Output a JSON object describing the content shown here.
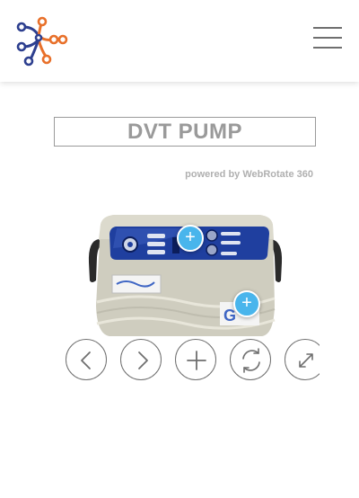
{
  "header": {
    "logo_icon": "network-nodes-logo",
    "menu_icon": "hamburger-menu-icon"
  },
  "viewer": {
    "title": "DVT PUMP",
    "powered_by": "powered by WebRotate 360",
    "product_image": "dvt-pump-device",
    "hotspot_label": "+",
    "controls": [
      {
        "icon": "chevron-left-icon"
      },
      {
        "icon": "chevron-right-icon"
      },
      {
        "icon": "zoom-plus-icon"
      },
      {
        "icon": "rotate-icon"
      },
      {
        "icon": "fullscreen-icon"
      }
    ]
  },
  "colors": {
    "accent": "#49b5ec",
    "logo_blue": "#2d3f8f",
    "logo_orange": "#e8702a",
    "device_panel": "#1f3f9f",
    "device_body": "#cfcdbf"
  }
}
